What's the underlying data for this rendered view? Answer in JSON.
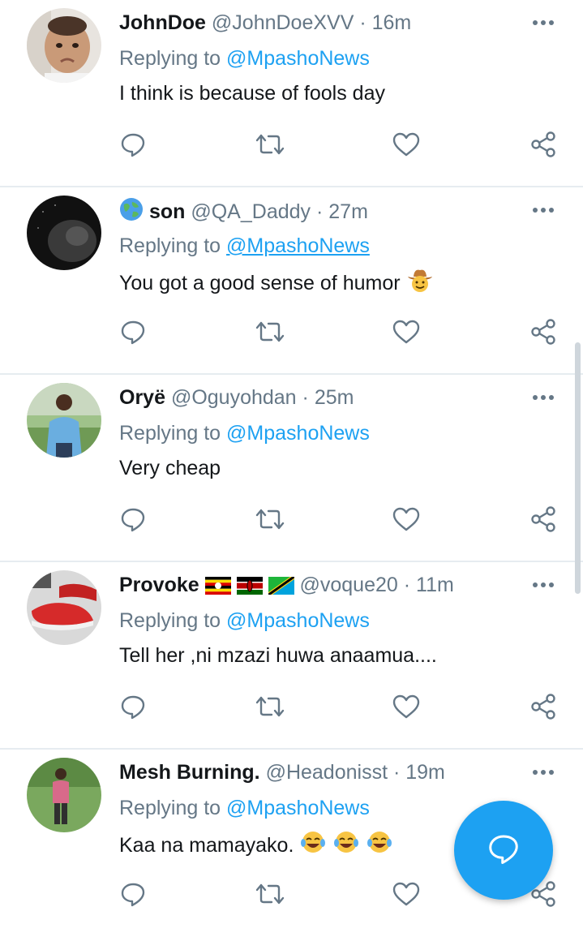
{
  "colors": {
    "accent": "#1da1f2",
    "secondary_text": "#657786",
    "primary_text": "#14171a",
    "divider": "#e6ecf0"
  },
  "tweets": [
    {
      "name": "JohnDoe",
      "handle": "@JohnDoeXVV",
      "sep": "·",
      "time": "16m",
      "replying_prefix": "Replying to",
      "replying_to": "@MpashoNews",
      "text": "I think is because of fools day",
      "avatar": "child-photo"
    },
    {
      "name": "son",
      "handle": "@QA_Daddy",
      "sep": "·",
      "time": "27m",
      "replying_prefix": "Replying to",
      "replying_to": "@MpashoNews",
      "text": "You got a good sense of humor",
      "avatar": "dark-lion-photo",
      "name_icon": "globe-emoji",
      "text_emoji": "cowboy-face-emoji"
    },
    {
      "name": "Oryë",
      "handle": "@Oguyohdan",
      "sep": "·",
      "time": "25m",
      "replying_prefix": "Replying to",
      "replying_to": "@MpashoNews",
      "text": "Very cheap",
      "avatar": "man-blue-shirt-photo"
    },
    {
      "name": "Provoke",
      "handle": "@voque20",
      "sep": "·",
      "time": "11m",
      "replying_prefix": "Replying to",
      "replying_to": "@MpashoNews",
      "text": "Tell her ,ni mzazi huwa anaamua....",
      "avatar": "red-sneakers-photo",
      "name_flags": [
        "uganda-flag-emoji",
        "kenya-flag-emoji",
        "tanzania-flag-emoji"
      ]
    },
    {
      "name": "Mesh Burning.",
      "handle": "@Headonisst",
      "sep": "·",
      "time": "19m",
      "replying_prefix": "Replying to",
      "replying_to": "@MpashoNews",
      "text": "Kaa na mamayako.",
      "avatar": "man-pink-shirt-photo",
      "text_emoji": "tears-of-joy-emoji x3"
    }
  ],
  "icons": {
    "more": "more-dots-icon",
    "reply": "reply-bubble-icon",
    "retweet": "retweet-icon",
    "like": "heart-icon",
    "share": "share-icon",
    "compose": "compose-reply-icon"
  }
}
